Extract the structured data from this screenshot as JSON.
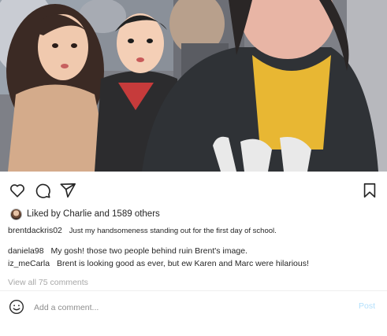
{
  "post": {
    "image_description_icon": "post-photo"
  },
  "actions": {
    "like_icon": "heart-icon",
    "comment_icon": "comment-icon",
    "share_icon": "send-icon",
    "save_icon": "bookmark-icon"
  },
  "likes": {
    "text": "Liked by Charlie and 1589 others"
  },
  "caption": {
    "username": "brentdackris02",
    "text": "Just my handsomeness standing out for the first day of school."
  },
  "comments": [
    {
      "username": "daniela98",
      "text": "My gosh! those two people behind ruin Brent's image."
    },
    {
      "username": "iz_meCarla",
      "text": "Brent is looking good as ever, but ew Karen and Marc were hilarious!"
    }
  ],
  "view_all": "View all 75 comments",
  "add_comment": {
    "placeholder": "Add a comment...",
    "post_label": "Post"
  },
  "colors": {
    "post_button_disabled": "#b2dffc",
    "muted_text": "#a8a8a8"
  }
}
